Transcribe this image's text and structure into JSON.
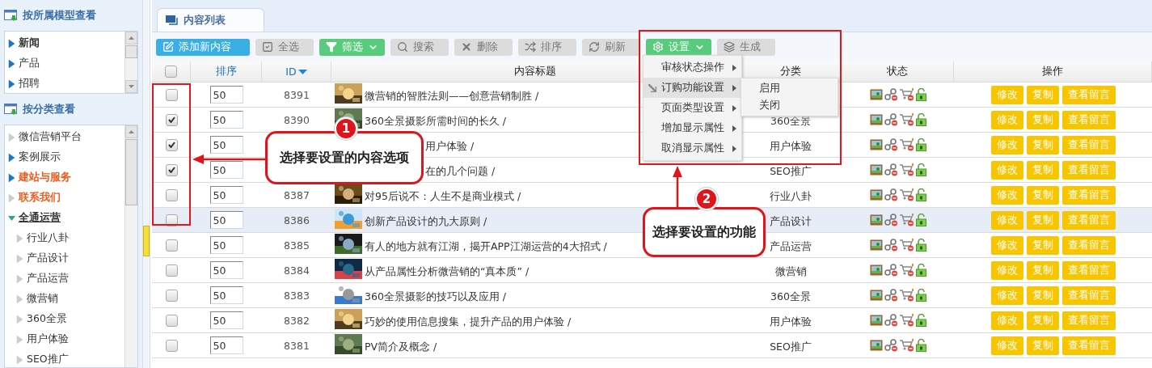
{
  "sidebar": {
    "sections": [
      {
        "title": "按所属模型查看",
        "kind": "list",
        "items": [
          {
            "label": "新闻",
            "selected": true
          },
          {
            "label": "产品",
            "selected": false
          },
          {
            "label": "招聘",
            "selected": false
          }
        ]
      },
      {
        "title": "按分类查看",
        "kind": "tree",
        "items": [
          {
            "label": "微信营销平台",
            "kind": "leaf",
            "highlighted": false,
            "selected": false,
            "expanded": false
          },
          {
            "label": "案例展示",
            "kind": "branch",
            "highlighted": false,
            "selected": false,
            "expanded": false
          },
          {
            "label": "建站与服务",
            "kind": "branch",
            "highlighted": true,
            "selected": false,
            "expanded": false
          },
          {
            "label": "联系我们",
            "kind": "leaf",
            "highlighted": true,
            "selected": false,
            "expanded": false
          },
          {
            "label": "全通运营",
            "kind": "branch",
            "highlighted": false,
            "selected": true,
            "expanded": true,
            "children": [
              {
                "label": "行业八卦",
                "kind": "leaf",
                "highlighted": false,
                "selected": false,
                "expanded": false
              },
              {
                "label": "产品设计",
                "kind": "leaf",
                "highlighted": false,
                "selected": false,
                "expanded": false
              },
              {
                "label": "产品运营",
                "kind": "leaf",
                "highlighted": false,
                "selected": false,
                "expanded": false
              },
              {
                "label": "微营销",
                "kind": "leaf",
                "highlighted": false,
                "selected": false,
                "expanded": false
              },
              {
                "label": "360全景",
                "kind": "leaf",
                "highlighted": false,
                "selected": false,
                "expanded": false
              },
              {
                "label": "用户体验",
                "kind": "leaf",
                "highlighted": false,
                "selected": false,
                "expanded": false
              },
              {
                "label": "SEO推广",
                "kind": "leaf",
                "highlighted": false,
                "selected": false,
                "expanded": false
              }
            ]
          }
        ]
      }
    ]
  },
  "tabs": [
    {
      "label": "内容列表",
      "selected": true
    }
  ],
  "toolbar": [
    {
      "label": "添加新内容",
      "kind": "primary",
      "dropdown": false
    },
    {
      "label": "全选",
      "kind": "default",
      "dropdown": false
    },
    {
      "label": "筛选",
      "kind": "success",
      "dropdown": true
    },
    {
      "label": "搜索",
      "kind": "default",
      "dropdown": false
    },
    {
      "label": "删除",
      "kind": "default",
      "dropdown": false
    },
    {
      "label": "排序",
      "kind": "default",
      "dropdown": false
    },
    {
      "label": "刷新",
      "kind": "default",
      "dropdown": false
    },
    {
      "label": "设置",
      "kind": "success",
      "dropdown": true
    },
    {
      "label": "生成",
      "kind": "default",
      "dropdown": false
    }
  ],
  "settings_menu": {
    "items": [
      {
        "label": "审核状态操作",
        "selected": false
      },
      {
        "label": "订购功能设置",
        "selected": true
      },
      {
        "label": "页面类型设置",
        "selected": false
      },
      {
        "label": "增加显示属性",
        "selected": false
      },
      {
        "label": "取消显示属性",
        "selected": false
      }
    ],
    "submenu": [
      "启用",
      "关闭"
    ]
  },
  "table": {
    "columns": [
      {
        "kind": "checkbox",
        "checked": false
      },
      {
        "kind": "text",
        "label": "排序",
        "link": true,
        "sorted": false
      },
      {
        "kind": "text",
        "label": "ID",
        "link": true,
        "sorted": true
      },
      {
        "kind": "text",
        "label": "内容标题",
        "link": false,
        "sorted": false
      },
      {
        "kind": "text",
        "label": "分类",
        "link": false,
        "sorted": false
      },
      {
        "kind": "text",
        "label": "状态",
        "link": false,
        "sorted": false
      },
      {
        "kind": "text",
        "label": "操作",
        "link": false,
        "sorted": false
      }
    ],
    "rows": [
      {
        "checked": false,
        "highlighted": false,
        "order": "50",
        "id": "8391",
        "title": "微营销的智胜法则——创意营销制胜 /",
        "title_covered": false,
        "actions": [
          "修改",
          "复制",
          "查看留言"
        ]
      },
      {
        "checked": true,
        "highlighted": false,
        "order": "50",
        "id": "8390",
        "title": "360全景摄影所需时间的长久 /",
        "title_covered": false,
        "category": "360全景",
        "actions": [
          "修改",
          "复制",
          "查看留言"
        ]
      },
      {
        "checked": true,
        "highlighted": false,
        "order": "50",
        "title": "用户体验 /",
        "title_covered": true,
        "category": "用户体验",
        "actions": [
          "修改",
          "复制",
          "查看留言"
        ]
      },
      {
        "checked": true,
        "highlighted": false,
        "order": "50",
        "title": "在的几个问题 /",
        "title_covered": true,
        "category": "SEO推广",
        "actions": [
          "修改",
          "复制",
          "查看留言"
        ]
      },
      {
        "checked": false,
        "highlighted": false,
        "order": "50",
        "id": "8387",
        "title": "对95后说不：人生不是商业模式 /",
        "title_covered": false,
        "category": "行业八卦",
        "actions": [
          "修改",
          "复制",
          "查看留言"
        ]
      },
      {
        "checked": false,
        "highlighted": true,
        "order": "50",
        "id": "8386",
        "title": "创新产品设计的九大原则 /",
        "title_covered": false,
        "category": "产品设计",
        "actions": [
          "修改",
          "复制",
          "查看留言"
        ]
      },
      {
        "checked": false,
        "highlighted": false,
        "order": "50",
        "id": "8385",
        "title": "有人的地方就有江湖，揭开APP江湖运营的4大招式 /",
        "title_covered": false,
        "category": "产品运营",
        "actions": [
          "修改",
          "复制",
          "查看留言"
        ]
      },
      {
        "checked": false,
        "highlighted": false,
        "order": "50",
        "id": "8384",
        "title": "从产品属性分析微营销的“真本质” /",
        "title_covered": false,
        "category": "微营销",
        "actions": [
          "修改",
          "复制",
          "查看留言"
        ]
      },
      {
        "checked": false,
        "highlighted": false,
        "order": "50",
        "id": "8383",
        "title": "360全景摄影的技巧以及应用 /",
        "title_covered": false,
        "category": "360全景",
        "actions": [
          "修改",
          "复制",
          "查看留言"
        ]
      },
      {
        "checked": false,
        "highlighted": false,
        "order": "50",
        "id": "8382",
        "title": "巧妙的使用信息搜集，提升产品的用户体验 /",
        "title_covered": false,
        "category": "用户体验",
        "actions": [
          "修改",
          "复制",
          "查看留言"
        ]
      },
      {
        "checked": false,
        "highlighted": false,
        "order": "50",
        "id": "8381",
        "title": "PV简介及概念 /",
        "title_covered": false,
        "category": "SEO推广",
        "actions": [
          "修改",
          "复制",
          "查看留言"
        ]
      }
    ]
  },
  "annotations": [
    {
      "number": "1",
      "text": "选择要设置的内容选项"
    },
    {
      "number": "2",
      "text": "选择要设置的功能"
    }
  ]
}
